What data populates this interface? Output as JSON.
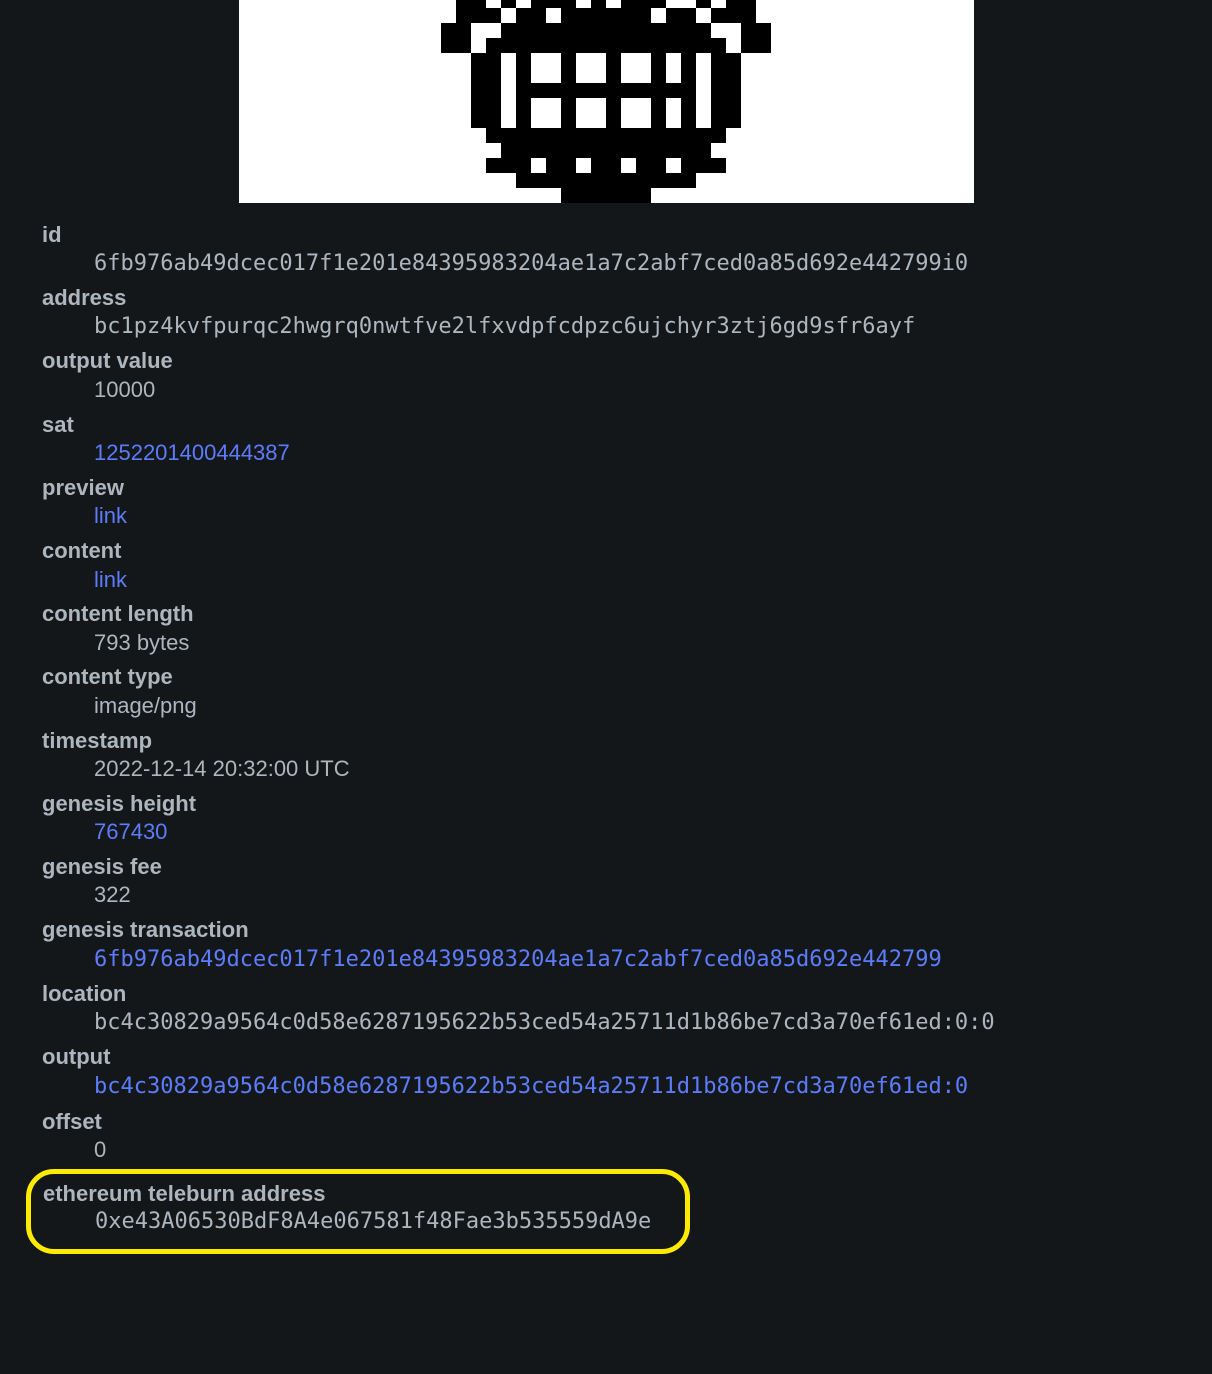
{
  "labels": {
    "id": "id",
    "address": "address",
    "output_value": "output value",
    "sat": "sat",
    "preview": "preview",
    "content": "content",
    "content_length": "content length",
    "content_type": "content type",
    "timestamp": "timestamp",
    "genesis_height": "genesis height",
    "genesis_fee": "genesis fee",
    "genesis_transaction": "genesis transaction",
    "location": "location",
    "output": "output",
    "offset": "offset",
    "ethereum_teleburn_address": "ethereum teleburn address"
  },
  "values": {
    "id": "6fb976ab49dcec017f1e201e84395983204ae1a7c2abf7ced0a85d692e442799i0",
    "address": "bc1pz4kvfpurqc2hwgrq0nwtfve2lfxvdpfcdpzc6ujchyr3ztj6gd9sfr6ayf",
    "output_value": "10000",
    "sat": "1252201400444387",
    "preview": "link",
    "content": "link",
    "content_length": "793 bytes",
    "content_type": "image/png",
    "timestamp": "2022-12-14 20:32:00 UTC",
    "genesis_height": "767430",
    "genesis_fee": "322",
    "genesis_transaction": "6fb976ab49dcec017f1e201e84395983204ae1a7c2abf7ced0a85d692e442799",
    "location": "bc4c30829a9564c0d58e6287195622b53ced54a25711d1b86be7cd3a70ef61ed:0:0",
    "output": "bc4c30829a9564c0d58e6287195622b53ced54a25711d1b86be7cd3a70ef61ed:0",
    "offset": "0",
    "ethereum_teleburn_address": "0xe43A06530BdF8A4e067581f48Fae3b535559dA9e"
  }
}
